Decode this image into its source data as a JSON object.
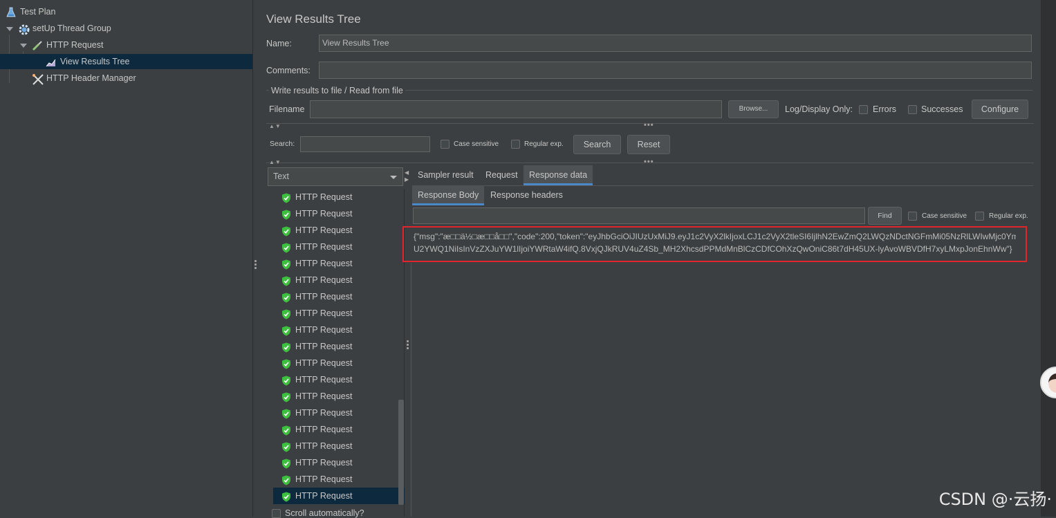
{
  "tree": {
    "items": [
      {
        "label": "Test Plan",
        "icon": "flask-icon"
      },
      {
        "label": "setUp Thread Group",
        "icon": "gear-icon"
      },
      {
        "label": "HTTP Request",
        "icon": "pipette-icon"
      },
      {
        "label": "View Results Tree",
        "icon": "chart-icon"
      },
      {
        "label": "HTTP Header Manager",
        "icon": "tools-icon"
      }
    ]
  },
  "panel": {
    "title": "View Results Tree",
    "name_label": "Name:",
    "name_value": "View Results Tree",
    "comments_label": "Comments:",
    "comments_value": "",
    "write_results_label": "Write results to file / Read from file",
    "filename_label": "Filename",
    "filename_value": "",
    "browse_label": "Browse...",
    "log_display_label": "Log/Display Only:",
    "errors_label": "Errors",
    "successes_label": "Successes",
    "configure_label": "Configure"
  },
  "search": {
    "label": "Search:",
    "value": "",
    "case_sensitive_label": "Case sensitive",
    "regex_label": "Regular exp.",
    "search_button": "Search",
    "reset_button": "Reset"
  },
  "renderer": {
    "selected": "Text"
  },
  "results": {
    "items": [
      "HTTP Request",
      "HTTP Request",
      "HTTP Request",
      "HTTP Request",
      "HTTP Request",
      "HTTP Request",
      "HTTP Request",
      "HTTP Request",
      "HTTP Request",
      "HTTP Request",
      "HTTP Request",
      "HTTP Request",
      "HTTP Request",
      "HTTP Request",
      "HTTP Request",
      "HTTP Request",
      "HTTP Request",
      "HTTP Request",
      "HTTP Request"
    ],
    "scroll_auto_label": "Scroll automatically?"
  },
  "tabs": {
    "main": [
      "Sampler result",
      "Request",
      "Response data"
    ],
    "sub": [
      "Response Body",
      "Response headers"
    ]
  },
  "find": {
    "value": "",
    "find_button": "Find",
    "case_sensitive_label": "Case sensitive",
    "regex_label": "Regular exp."
  },
  "response": {
    "line1": "{\"msg\":\"æ□□ä½□æ□□å□□\",\"code\":200,\"token\":\"eyJhbGciOiJIUzUxMiJ9.eyJ1c2VyX2lkIjoxLCJ1c2VyX2tleSI6IjlhN2EwZmQ2LWQzNDctNGFmMi05NzRlLWIwMjc0Ym",
    "line2": "U2YWQ1NiIsInVzZXJuYW1lIjoiYWRtaW4ifQ.8VxjQJkRUV4uZ4Sb_MH2XhcsdPPMdMnBlCzCDfCOhXzQwOniC86t7dH45UX-lyAvoWBVDfH7xyLMxpJonEhnWw\"}"
  },
  "watermark": "CSDN @·云扬·",
  "colors": {
    "background": "#3c3f41",
    "selection": "#0d293e",
    "highlight_box": "#e0262a",
    "success_green": "#3fbf3f",
    "tab_accent": "#4a88c7"
  }
}
